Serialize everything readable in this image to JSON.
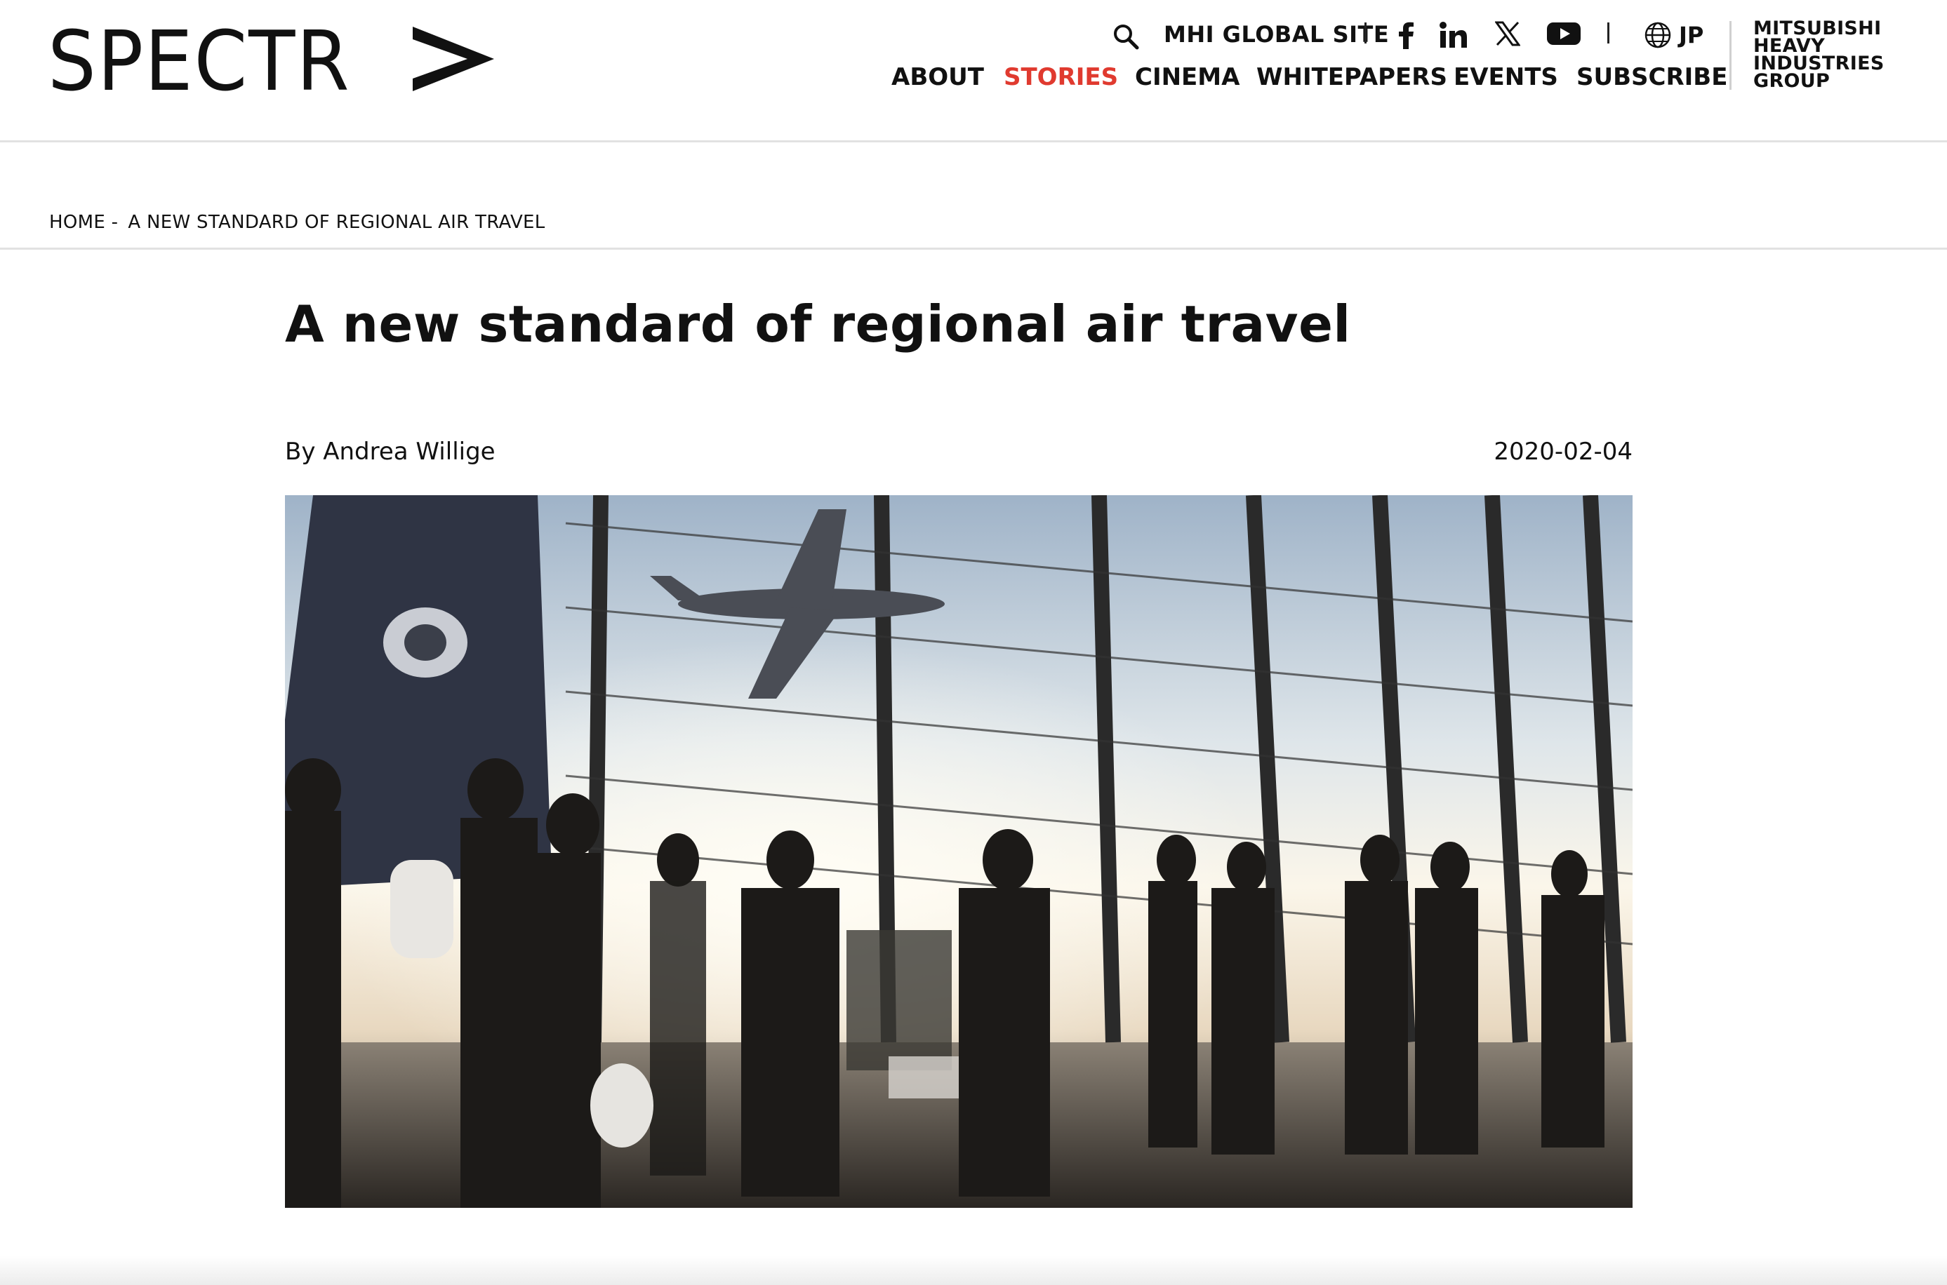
{
  "brand": {
    "logo_text": "SPECTR",
    "logo_icon": "triangle-a-icon"
  },
  "utility": {
    "global_site": "MHI GLOBAL SITE",
    "language": "JP",
    "icons": [
      "search-icon",
      "facebook-icon",
      "linkedin-icon",
      "x-icon",
      "youtube-icon",
      "globe-icon"
    ]
  },
  "nav": {
    "items": [
      "ABOUT",
      "STORIES",
      "CINEMA",
      "WHITEPAPERS",
      "EVENTS",
      "SUBSCRIBE"
    ],
    "active": "STORIES"
  },
  "group_logo": {
    "line1": "MITSUBISHI",
    "line2": "HEAVY",
    "line3": "INDUSTRIES",
    "line4": "GROUP"
  },
  "breadcrumb": {
    "home": "HOME -",
    "current": "A NEW STANDARD OF REGIONAL AIR TRAVEL"
  },
  "article": {
    "title": "A new standard of regional air travel",
    "byline": "By Andrea Willige",
    "date": "2020-02-04",
    "hero_image": "airport-terminal-photo"
  },
  "colors": {
    "accent": "#e03a2f",
    "text": "#111111",
    "divider": "#e2e2e2"
  }
}
